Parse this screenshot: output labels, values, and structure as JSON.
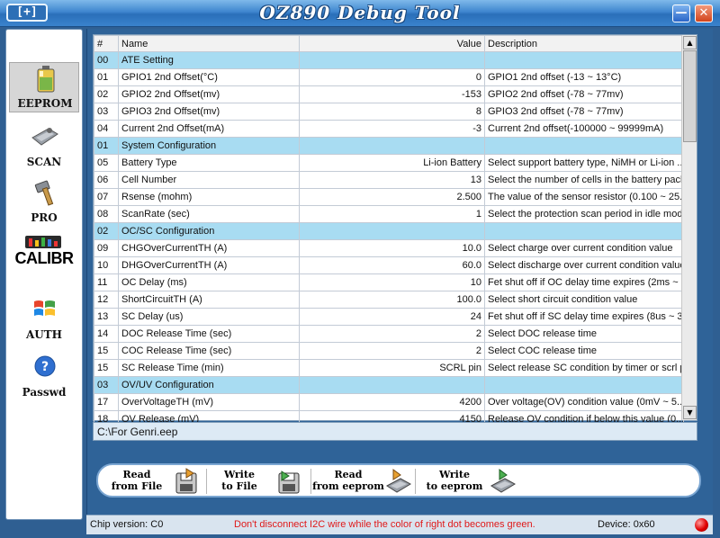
{
  "window": {
    "title": "OZ890 Debug Tool",
    "app_icon_text": "[+]",
    "minimize_glyph": "—",
    "close_glyph": "✕"
  },
  "sidebar": {
    "items": [
      {
        "label": "EEPROM",
        "icon": "battery-icon",
        "active": true
      },
      {
        "label": "SCAN",
        "icon": "chip-icon",
        "active": false
      },
      {
        "label": "PRO",
        "icon": "hammer-icon",
        "active": false
      },
      {
        "label": "CALIBR",
        "icon": "calibrate-meter-icon",
        "active": false
      },
      {
        "label": "AUTH",
        "icon": "windows-flag-icon",
        "active": false
      },
      {
        "label": "Passwd",
        "icon": "help-question-icon",
        "active": false
      }
    ]
  },
  "grid": {
    "headers": {
      "num": "#",
      "name": "Name",
      "value": "Value",
      "desc": "Description"
    },
    "rows": [
      {
        "num": "00",
        "name": "ATE Setting",
        "value": "",
        "desc": "",
        "section": true
      },
      {
        "num": "01",
        "name": "GPIO1 2nd Offset(°C)",
        "value": "0",
        "desc": "GPIO1 2nd offset (-13 ~ 13°C)"
      },
      {
        "num": "02",
        "name": "GPIO2 2nd Offset(mv)",
        "value": "-153",
        "desc": "GPIO2 2nd offset (-78 ~ 77mv)"
      },
      {
        "num": "03",
        "name": "GPIO3 2nd Offset(mv)",
        "value": "8",
        "desc": "GPIO3 2nd offset (-78 ~ 77mv)"
      },
      {
        "num": "04",
        "name": "Current 2nd Offset(mA)",
        "value": "-3",
        "desc": "Current 2nd offset(-100000 ~ 99999mA)"
      },
      {
        "num": "01",
        "name": "System Configuration",
        "value": "",
        "desc": "",
        "section": true
      },
      {
        "num": "05",
        "name": "Battery Type",
        "value": "Li-ion Battery",
        "desc": "Select support battery type, NiMH or Li-ion ..."
      },
      {
        "num": "06",
        "name": "Cell Number",
        "value": "13",
        "desc": "Select the number of cells in the battery pack"
      },
      {
        "num": "07",
        "name": "Rsense (mohm)",
        "value": "2.500",
        "desc": "The value of the sensor resistor (0.100 ~ 25..."
      },
      {
        "num": "08",
        "name": "ScanRate (sec)",
        "value": "1",
        "desc": "Select the protection scan period in idle mode"
      },
      {
        "num": "02",
        "name": "OC/SC Configuration",
        "value": "",
        "desc": "",
        "section": true
      },
      {
        "num": "09",
        "name": "CHGOverCurrentTH (A)",
        "value": "10.0",
        "desc": "Select charge over current condition value"
      },
      {
        "num": "10",
        "name": "DHGOverCurrentTH (A)",
        "value": "60.0",
        "desc": "Select discharge over current condition value"
      },
      {
        "num": "11",
        "name": "OC Delay (ms)",
        "value": "10",
        "desc": "Fet shut off if OC delay time expires (2ms ~ ..."
      },
      {
        "num": "12",
        "name": "ShortCircuitTH (A)",
        "value": "100.0",
        "desc": "Select short circuit condition value"
      },
      {
        "num": "13",
        "name": "SC Delay (us)",
        "value": "24",
        "desc": "Fet shut off if SC delay time expires (8us ~ 3..."
      },
      {
        "num": "14",
        "name": "DOC Release Time (sec)",
        "value": "2",
        "desc": "Select DOC release time"
      },
      {
        "num": "15",
        "name": "COC Release Time (sec)",
        "value": "2",
        "desc": "Select COC release time"
      },
      {
        "num": "15",
        "name": "SC Release Time (min)",
        "value": "SCRL pin",
        "desc": "Select release SC condition by timer or scrl pin"
      },
      {
        "num": "03",
        "name": "OV/UV Configuration",
        "value": "",
        "desc": "",
        "section": true
      },
      {
        "num": "17",
        "name": "OverVoltageTH (mV)",
        "value": "4200",
        "desc": "Over voltage(OV) condition value (0mV ~ 5..."
      },
      {
        "num": "18",
        "name": "OV Release (mV)",
        "value": "4150",
        "desc": "Release OV condition if below this value (0..."
      }
    ]
  },
  "scrollbar": {
    "up": "▲",
    "down": "▼"
  },
  "file_path": "C:\\For Genri.eep",
  "toolbar": {
    "read_file": {
      "line1": "Read",
      "line2": "from File"
    },
    "write_file": {
      "line1": "Write",
      "line2": "to File"
    },
    "read_eeprom": {
      "line1": "Read",
      "line2": "from eeprom"
    },
    "write_eeprom": {
      "line1": "Write",
      "line2": "to eeprom"
    }
  },
  "status": {
    "chip_version": "Chip version: C0",
    "warning": "Don't disconnect I2C wire while the color of right dot becomes green.",
    "device": "Device: 0x60",
    "led_color": "#e00000"
  }
}
